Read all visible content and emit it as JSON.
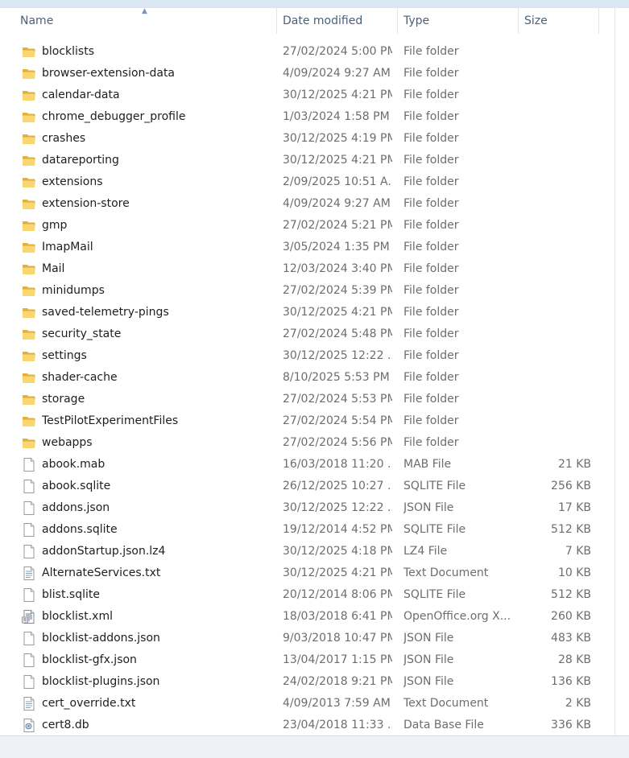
{
  "columns": {
    "name": "Name",
    "date": "Date modified",
    "type": "Type",
    "size": "Size"
  },
  "files": [
    {
      "name": "blocklists",
      "date": "27/02/2024 5:00 PM",
      "type": "File folder",
      "size": "",
      "icon": "folder-icon"
    },
    {
      "name": "browser-extension-data",
      "date": "4/09/2024 9:27 AM",
      "type": "File folder",
      "size": "",
      "icon": "folder-icon"
    },
    {
      "name": "calendar-data",
      "date": "30/12/2025 4:21 PM",
      "type": "File folder",
      "size": "",
      "icon": "folder-icon"
    },
    {
      "name": "chrome_debugger_profile",
      "date": "1/03/2024 1:58 PM",
      "type": "File folder",
      "size": "",
      "icon": "folder-icon"
    },
    {
      "name": "crashes",
      "date": "30/12/2025 4:19 PM",
      "type": "File folder",
      "size": "",
      "icon": "folder-icon"
    },
    {
      "name": "datareporting",
      "date": "30/12/2025 4:21 PM",
      "type": "File folder",
      "size": "",
      "icon": "folder-icon"
    },
    {
      "name": "extensions",
      "date": "2/09/2025 10:51 A...",
      "type": "File folder",
      "size": "",
      "icon": "folder-icon"
    },
    {
      "name": "extension-store",
      "date": "4/09/2024 9:27 AM",
      "type": "File folder",
      "size": "",
      "icon": "folder-icon"
    },
    {
      "name": "gmp",
      "date": "27/02/2024 5:21 PM",
      "type": "File folder",
      "size": "",
      "icon": "folder-icon"
    },
    {
      "name": "ImapMail",
      "date": "3/05/2024 1:35 PM",
      "type": "File folder",
      "size": "",
      "icon": "folder-icon"
    },
    {
      "name": "Mail",
      "date": "12/03/2024 3:40 PM",
      "type": "File folder",
      "size": "",
      "icon": "folder-icon"
    },
    {
      "name": "minidumps",
      "date": "27/02/2024 5:39 PM",
      "type": "File folder",
      "size": "",
      "icon": "folder-icon"
    },
    {
      "name": "saved-telemetry-pings",
      "date": "30/12/2025 4:21 PM",
      "type": "File folder",
      "size": "",
      "icon": "folder-icon"
    },
    {
      "name": "security_state",
      "date": "27/02/2024 5:48 PM",
      "type": "File folder",
      "size": "",
      "icon": "folder-icon"
    },
    {
      "name": "settings",
      "date": "30/12/2025 12:22 ...",
      "type": "File folder",
      "size": "",
      "icon": "folder-icon"
    },
    {
      "name": "shader-cache",
      "date": "8/10/2025 5:53 PM",
      "type": "File folder",
      "size": "",
      "icon": "folder-icon"
    },
    {
      "name": "storage",
      "date": "27/02/2024 5:53 PM",
      "type": "File folder",
      "size": "",
      "icon": "folder-icon"
    },
    {
      "name": "TestPilotExperimentFiles",
      "date": "27/02/2024 5:54 PM",
      "type": "File folder",
      "size": "",
      "icon": "folder-icon"
    },
    {
      "name": "webapps",
      "date": "27/02/2024 5:56 PM",
      "type": "File folder",
      "size": "",
      "icon": "folder-icon"
    },
    {
      "name": "abook.mab",
      "date": "16/03/2018 11:20 ...",
      "type": "MAB File",
      "size": "21 KB",
      "icon": "file-icon"
    },
    {
      "name": "abook.sqlite",
      "date": "26/12/2025 10:27 ...",
      "type": "SQLITE File",
      "size": "256 KB",
      "icon": "file-icon"
    },
    {
      "name": "addons.json",
      "date": "30/12/2025 12:22 ...",
      "type": "JSON File",
      "size": "17 KB",
      "icon": "file-icon"
    },
    {
      "name": "addons.sqlite",
      "date": "19/12/2014 4:52 PM",
      "type": "SQLITE File",
      "size": "512 KB",
      "icon": "file-icon"
    },
    {
      "name": "addonStartup.json.lz4",
      "date": "30/12/2025 4:18 PM",
      "type": "LZ4 File",
      "size": "7 KB",
      "icon": "file-icon"
    },
    {
      "name": "AlternateServices.txt",
      "date": "30/12/2025 4:21 PM",
      "type": "Text Document",
      "size": "10 KB",
      "icon": "text-document-icon"
    },
    {
      "name": "blist.sqlite",
      "date": "20/12/2014 8:06 PM",
      "type": "SQLITE File",
      "size": "512 KB",
      "icon": "file-icon"
    },
    {
      "name": "blocklist.xml",
      "date": "18/03/2018 6:41 PM",
      "type": "OpenOffice.org X...",
      "size": "260 KB",
      "icon": "xml-document-icon"
    },
    {
      "name": "blocklist-addons.json",
      "date": "9/03/2018 10:47 PM",
      "type": "JSON File",
      "size": "483 KB",
      "icon": "file-icon"
    },
    {
      "name": "blocklist-gfx.json",
      "date": "13/04/2017 1:15 PM",
      "type": "JSON File",
      "size": "28 KB",
      "icon": "file-icon"
    },
    {
      "name": "blocklist-plugins.json",
      "date": "24/02/2018 9:21 PM",
      "type": "JSON File",
      "size": "136 KB",
      "icon": "file-icon"
    },
    {
      "name": "cert_override.txt",
      "date": "4/09/2013 7:59 AM",
      "type": "Text Document",
      "size": "2 KB",
      "icon": "text-document-icon"
    },
    {
      "name": "cert8.db",
      "date": "23/04/2018 11:33 ...",
      "type": "Data Base File",
      "size": "336 KB",
      "icon": "database-file-icon"
    }
  ]
}
